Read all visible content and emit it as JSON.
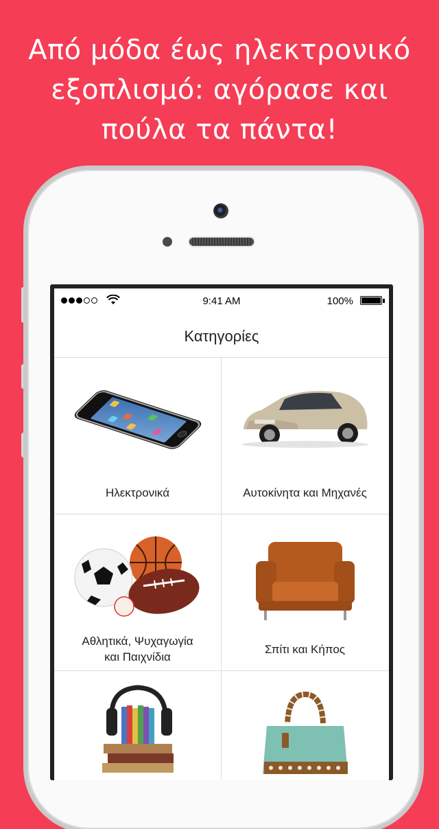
{
  "headline": {
    "line1": "Από μόδα έως ηλεκτρονικό",
    "line2": "εξοπλισμό: αγόρασε και",
    "line3": "πούλα τα πάντα!"
  },
  "status_bar": {
    "time": "9:41 AM",
    "battery": "100%"
  },
  "nav": {
    "title": "Κατηγορίες"
  },
  "categories": [
    {
      "label": "Ηλεκτρονικά",
      "icon": "smartphone-image"
    },
    {
      "label": "Αυτοκίνητα και Μηχανές",
      "icon": "car-image"
    },
    {
      "label_line1": "Αθλητικά, Ψυχαγωγία",
      "label_line2": "και Παιχνίδια",
      "icon": "sports-balls-image"
    },
    {
      "label": "Σπίτι και Κήπος",
      "icon": "armchair-image"
    },
    {
      "label": "",
      "icon": "music-books-image"
    },
    {
      "label": "",
      "icon": "handbag-image"
    }
  ],
  "colors": {
    "background": "#f53d56",
    "screen": "#ffffff"
  }
}
